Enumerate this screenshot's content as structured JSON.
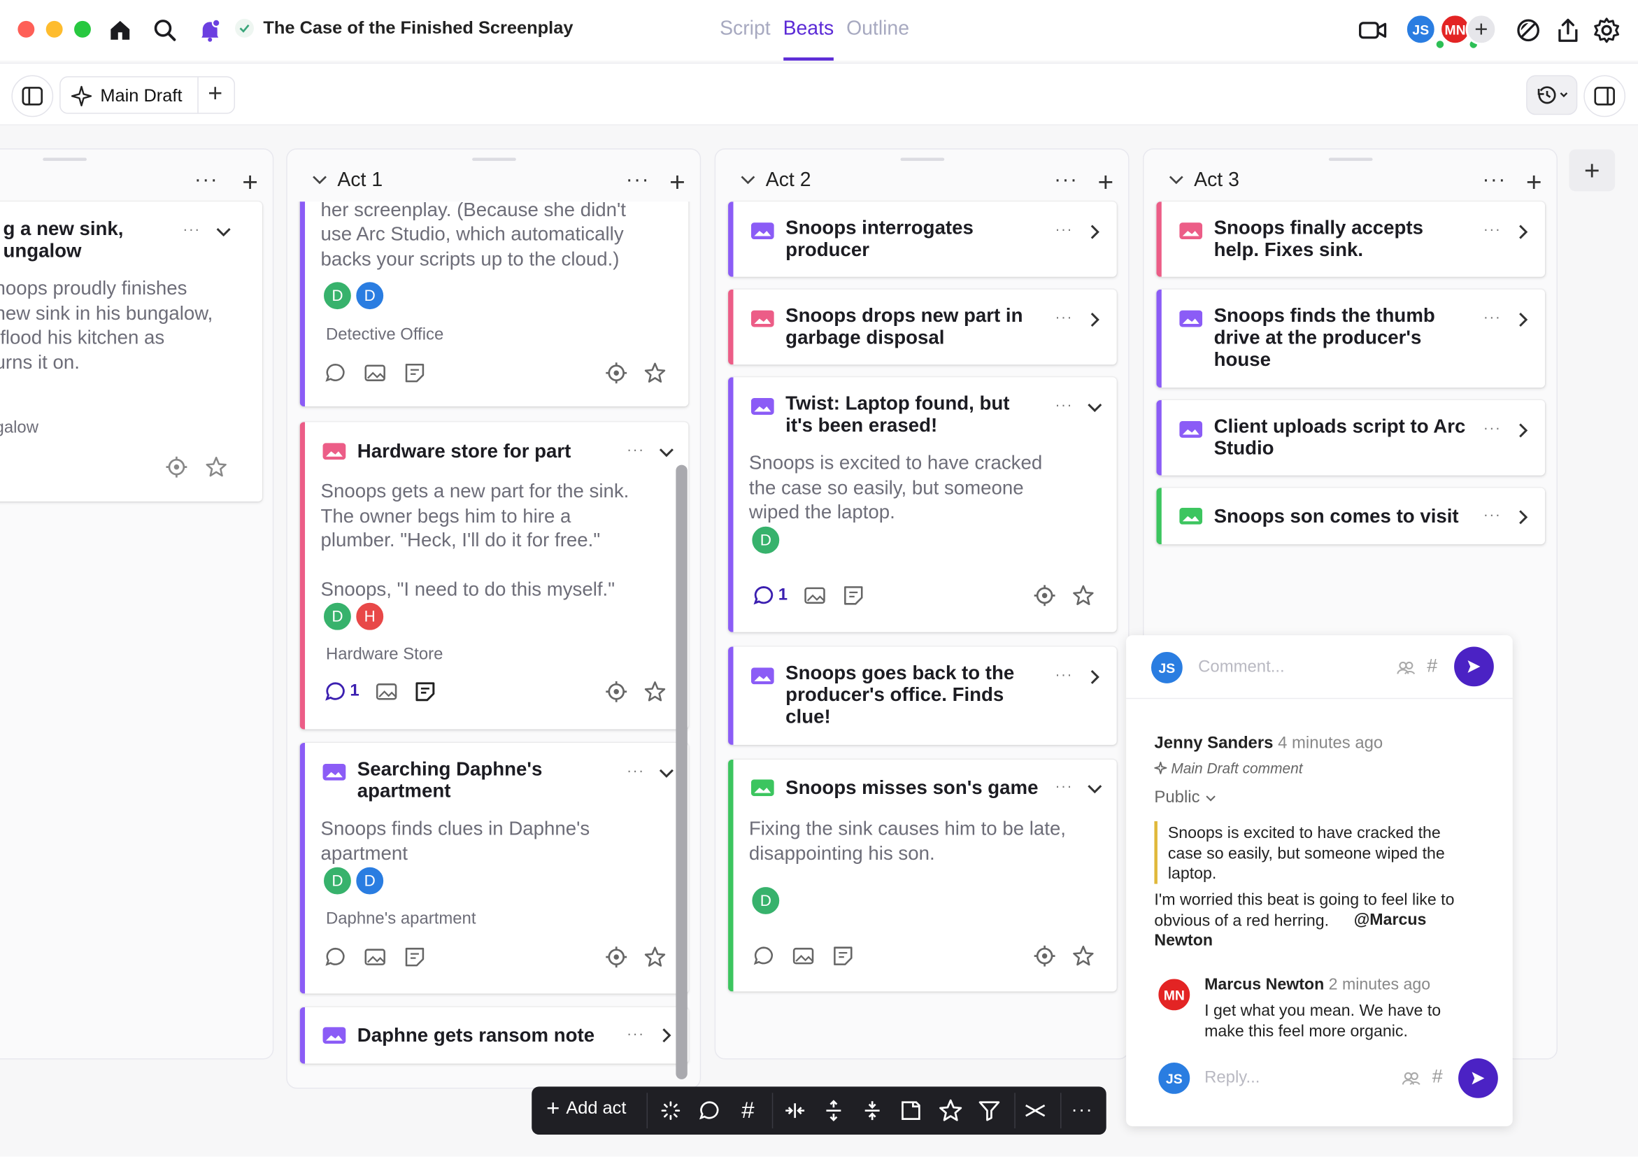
{
  "window": {
    "title": "The Case of the Finished Screenplay"
  },
  "tabs": [
    {
      "label": "Script"
    },
    {
      "label": "Beats",
      "active": true
    },
    {
      "label": "Outline"
    }
  ],
  "collaborators": [
    {
      "initials": "JS",
      "color": "#2a7de1"
    },
    {
      "initials": "MN",
      "color": "#e32424"
    }
  ],
  "toolbar": {
    "draft_label": "Main Draft"
  },
  "colors": {
    "accent": "#5b2ad6",
    "purple": "#8b5cf6",
    "pink": "#ec5d87",
    "green": "#3cc55f",
    "avatar_green": "#37b26c",
    "avatar_blue": "#2a7de1",
    "avatar_red": "#e84848"
  },
  "columns": [
    {
      "name": "",
      "cards": [
        {
          "title_l1": "g a new sink,",
          "title_l2": "ungalow",
          "body": "noops proudly finishes\nnew sink in his bungalow,\n flood his kitchen as\nurns it on.",
          "location": "galow"
        }
      ]
    },
    {
      "name": "Act 1",
      "cards": [
        {
          "body": "laptop containing the only copy of\nher screenplay. (Because she didn't\nuse Arc Studio, which automatically\nbacks your scripts up to the cloud.)",
          "location": "Detective Office",
          "avatars": [
            "D",
            "D"
          ]
        },
        {
          "title": "Hardware store for part",
          "body1": "Snoops gets a new part for the sink.\nThe owner begs him to hire a\nplumber. \"Heck, I'll do it for free.\"",
          "body2": "Snoops, \"I need to do this myself.\"",
          "avatars": [
            "D",
            "H"
          ],
          "location": "Hardware Store",
          "comments": "1"
        },
        {
          "title_l1": "Searching Daphne's",
          "title_l2": "apartment",
          "body": "Snoops finds clues in Daphne's\napartment",
          "avatars": [
            "D",
            "D"
          ],
          "location": "Daphne's apartment"
        },
        {
          "title": "Daphne gets ransom note"
        }
      ]
    },
    {
      "name": "Act 2",
      "cards": [
        {
          "title_l1": "Snoops interrogates",
          "title_l2": "producer"
        },
        {
          "title_l1": "Snoops drops new part in",
          "title_l2": "garbage disposal"
        },
        {
          "title_l1": "Twist: Laptop found, but",
          "title_l2": "it's been erased!",
          "body": "Snoops is excited to have cracked\nthe case so easily, but someone\nwiped the laptop.",
          "avatars": [
            "D"
          ],
          "comments": "1"
        },
        {
          "title_l1": "Snoops goes back to the",
          "title_l2": "producer's office. Finds",
          "title_l3": "clue!"
        },
        {
          "title": "Snoops misses son's game",
          "body": "Fixing the sink causes him to be late,\ndisappointing his son.",
          "avatars": [
            "D"
          ]
        }
      ]
    },
    {
      "name": "Act 3",
      "cards": [
        {
          "title_l1": "Snoops finally accepts",
          "title_l2": "help. Fixes sink."
        },
        {
          "title_l1": "Snoops finds the thumb",
          "title_l2": "drive at the producer's",
          "title_l3": "house"
        },
        {
          "title_l1": "Client uploads script to Arc",
          "title_l2": "Studio"
        },
        {
          "title": "Snoops son comes to visit"
        }
      ]
    }
  ],
  "comment_panel": {
    "input_placeholder": "Comment...",
    "author": "Jenny Sanders",
    "time": "4 minutes ago",
    "draft_tag": "Main Draft comment",
    "visibility": "Public",
    "quote": "Snoops is excited to have cracked the\ncase so easily, but someone wiped the\nlaptop.",
    "text": "I'm worried this beat is going to feel like to\nobvious of a red herring.",
    "mention_l1": "@Marcus",
    "mention_l2": "Newton",
    "reply_author": "Marcus Newton",
    "reply_time": "2 minutes ago",
    "reply_text": "I get what you mean. We have to\nmake this feel more organic.",
    "reply_placeholder": "Reply...",
    "user_initials": "JS",
    "reply_initials": "MN",
    "hash": "#"
  },
  "bottombar": {
    "add_act": "Add act"
  }
}
